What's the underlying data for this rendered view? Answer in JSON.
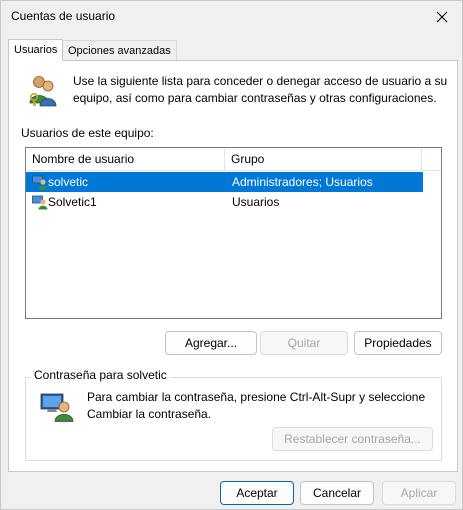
{
  "window": {
    "title": "Cuentas de usuario"
  },
  "tabs": [
    {
      "label": "Usuarios",
      "active": true
    },
    {
      "label": "Opciones avanzadas",
      "active": false
    }
  ],
  "intro": {
    "text": "Use la siguiente lista para conceder o denegar acceso de usuario a su equipo, así como para cambiar contraseñas y otras configuraciones.",
    "icon": "users-keys-icon"
  },
  "users_list": {
    "label": "Usuarios de este equipo:",
    "columns": [
      "Nombre de usuario",
      "Grupo"
    ],
    "rows": [
      {
        "name": "solvetic",
        "group": "Administradores; Usuarios",
        "selected": true
      },
      {
        "name": "Solvetic1",
        "group": "Usuarios",
        "selected": false
      }
    ]
  },
  "list_buttons": {
    "add": "Agregar...",
    "remove": "Quitar",
    "properties": "Propiedades"
  },
  "password_section": {
    "title": "Contraseña para solvetic",
    "text": "Para cambiar la contraseña, presione Ctrl-Alt-Supr y seleccione Cambiar la contraseña.",
    "reset_button": "Restablecer contraseña..."
  },
  "footer": {
    "ok": "Aceptar",
    "cancel": "Cancelar",
    "apply": "Aplicar"
  },
  "colors": {
    "selection": "#0078d7",
    "window_bg": "#f0f0f0",
    "panel_bg": "#ffffff"
  }
}
